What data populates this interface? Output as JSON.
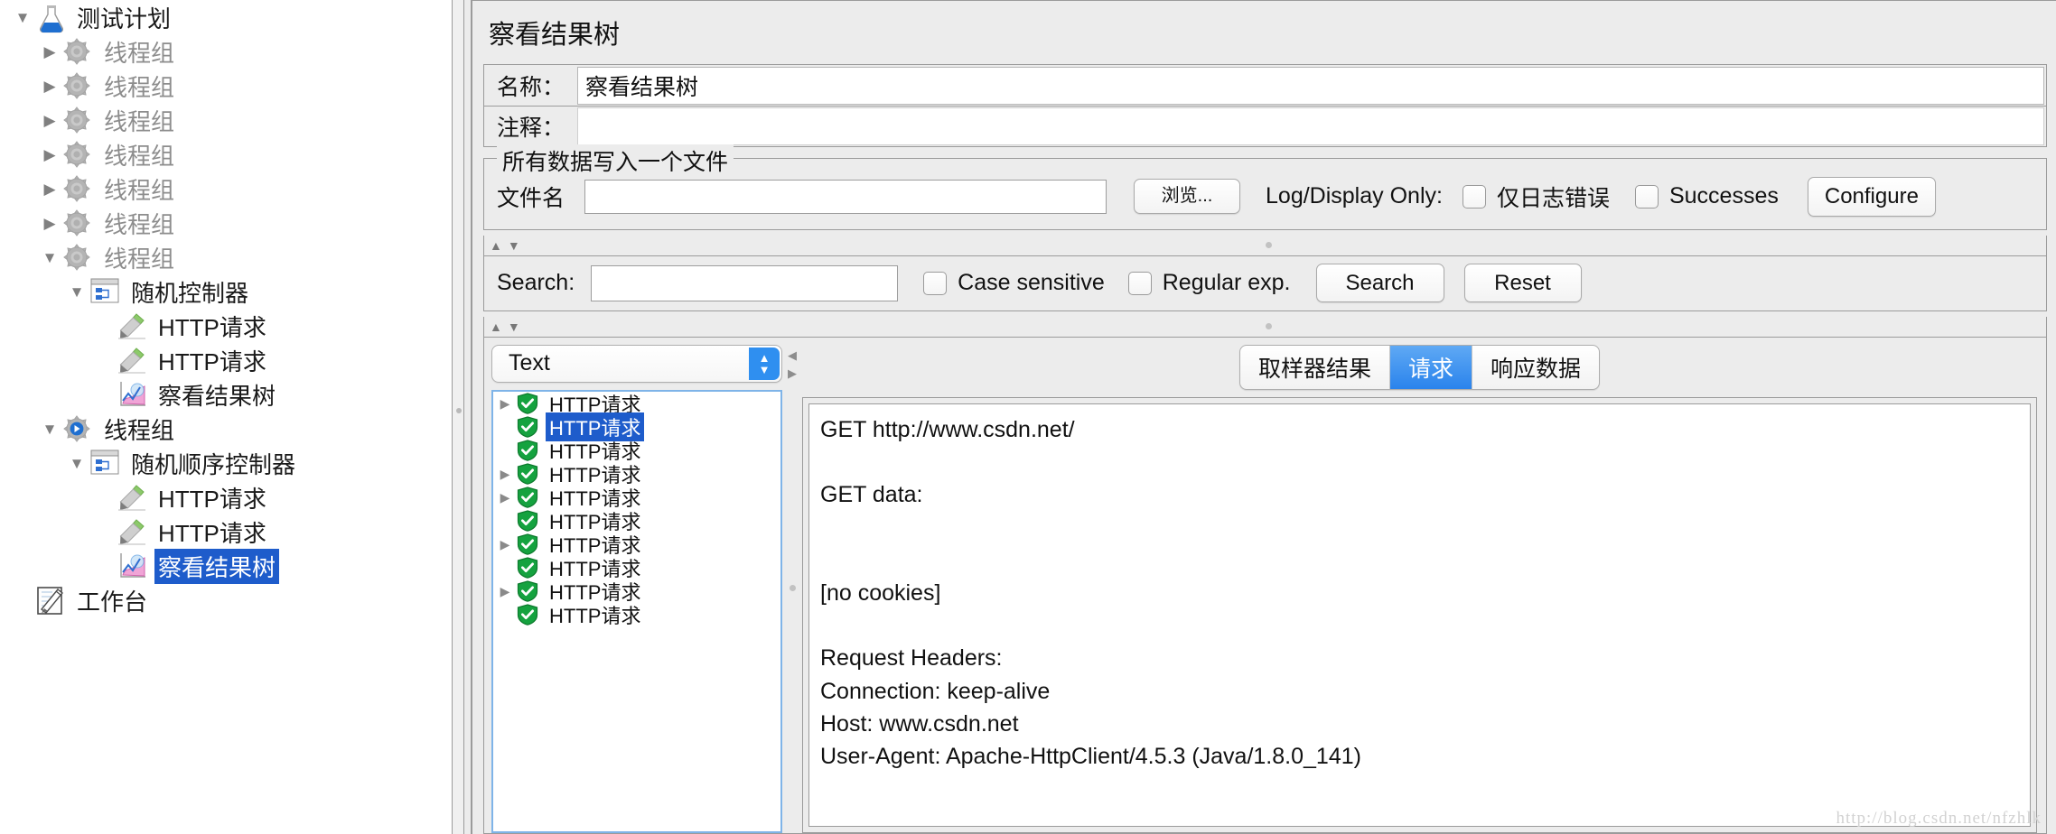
{
  "tree": {
    "nodes": [
      {
        "label": "测试计划",
        "indent": 0,
        "toggle": "▼",
        "icon": "flask-icon",
        "state": "normal"
      },
      {
        "label": "线程组",
        "indent": 1,
        "toggle": "▶",
        "icon": "thread-group-icon",
        "state": "disabled"
      },
      {
        "label": "线程组",
        "indent": 1,
        "toggle": "▶",
        "icon": "thread-group-icon",
        "state": "disabled"
      },
      {
        "label": "线程组",
        "indent": 1,
        "toggle": "▶",
        "icon": "thread-group-icon",
        "state": "disabled"
      },
      {
        "label": "线程组",
        "indent": 1,
        "toggle": "▶",
        "icon": "thread-group-icon",
        "state": "disabled"
      },
      {
        "label": "线程组",
        "indent": 1,
        "toggle": "▶",
        "icon": "thread-group-icon",
        "state": "disabled"
      },
      {
        "label": "线程组",
        "indent": 1,
        "toggle": "▶",
        "icon": "thread-group-icon",
        "state": "disabled"
      },
      {
        "label": "线程组",
        "indent": 1,
        "toggle": "▼",
        "icon": "thread-group-icon",
        "state": "disabled"
      },
      {
        "label": "随机控制器",
        "indent": 2,
        "toggle": "▼",
        "icon": "controller-icon",
        "state": "normal"
      },
      {
        "label": "HTTP请求",
        "indent": 3,
        "toggle": "",
        "icon": "http-sampler-icon",
        "state": "normal"
      },
      {
        "label": "HTTP请求",
        "indent": 3,
        "toggle": "",
        "icon": "http-sampler-icon",
        "state": "normal"
      },
      {
        "label": "察看结果树",
        "indent": 3,
        "toggle": "",
        "icon": "view-results-tree-icon",
        "state": "normal"
      },
      {
        "label": "线程组",
        "indent": 1,
        "toggle": "▼",
        "icon": "thread-group-active-icon",
        "state": "normal"
      },
      {
        "label": "随机顺序控制器",
        "indent": 2,
        "toggle": "▼",
        "icon": "controller-icon",
        "state": "normal"
      },
      {
        "label": "HTTP请求",
        "indent": 3,
        "toggle": "",
        "icon": "http-sampler-icon",
        "state": "normal"
      },
      {
        "label": "HTTP请求",
        "indent": 3,
        "toggle": "",
        "icon": "http-sampler-icon",
        "state": "normal"
      },
      {
        "label": "察看结果树",
        "indent": 3,
        "toggle": "",
        "icon": "view-results-tree-icon",
        "state": "selected"
      },
      {
        "label": "工作台",
        "indent": 0,
        "toggle": "",
        "icon": "workbench-icon",
        "state": "normal"
      }
    ]
  },
  "panel": {
    "title": "察看结果树",
    "name_label": "名称：",
    "name_value": "察看结果树",
    "comment_label": "注释：",
    "comment_value": "",
    "filegroup": {
      "title": "所有数据写入一个文件",
      "filename_label": "文件名",
      "filename_value": "",
      "browse_button": "浏览...",
      "log_display_label": "Log/Display Only:",
      "errors_checkbox": "仅日志错误",
      "errors_checked": false,
      "successes_checkbox": "Successes",
      "successes_checked": false,
      "configure_button": "Configure"
    },
    "search": {
      "label": "Search:",
      "value": "",
      "case_sensitive_label": "Case sensitive",
      "case_sensitive_checked": false,
      "regular_exp_label": "Regular exp.",
      "regular_exp_checked": false,
      "search_button": "Search",
      "reset_button": "Reset"
    },
    "renderer": {
      "selected": "Text"
    },
    "results": [
      {
        "label": "HTTP请求",
        "toggle": "▶",
        "status": "success",
        "selected": false
      },
      {
        "label": "HTTP请求",
        "toggle": "",
        "status": "success",
        "selected": true
      },
      {
        "label": "HTTP请求",
        "toggle": "",
        "status": "success",
        "selected": false
      },
      {
        "label": "HTTP请求",
        "toggle": "▶",
        "status": "success",
        "selected": false
      },
      {
        "label": "HTTP请求",
        "toggle": "▶",
        "status": "success",
        "selected": false
      },
      {
        "label": "HTTP请求",
        "toggle": "",
        "status": "success",
        "selected": false
      },
      {
        "label": "HTTP请求",
        "toggle": "▶",
        "status": "success",
        "selected": false
      },
      {
        "label": "HTTP请求",
        "toggle": "",
        "status": "success",
        "selected": false
      },
      {
        "label": "HTTP请求",
        "toggle": "▶",
        "status": "success",
        "selected": false
      },
      {
        "label": "HTTP请求",
        "toggle": "",
        "status": "success",
        "selected": false
      }
    ],
    "tabs": [
      {
        "label": "取样器结果",
        "active": false
      },
      {
        "label": "请求",
        "active": true
      },
      {
        "label": "响应数据",
        "active": false
      }
    ],
    "request_text": "GET http://www.csdn.net/\n\nGET data:\n\n\n[no cookies]\n\nRequest Headers:\nConnection: keep-alive\nHost: www.csdn.net\nUser-Agent: Apache-HttpClient/4.5.3 (Java/1.8.0_141)\n"
  },
  "watermark": "http://blog.csdn.net/nfzhlk",
  "colors": {
    "selection_blue": "#1e5ccb",
    "tab_active_blue": "#2a83ec",
    "success_green": "#14a03c",
    "panel_bg": "#ececec"
  }
}
